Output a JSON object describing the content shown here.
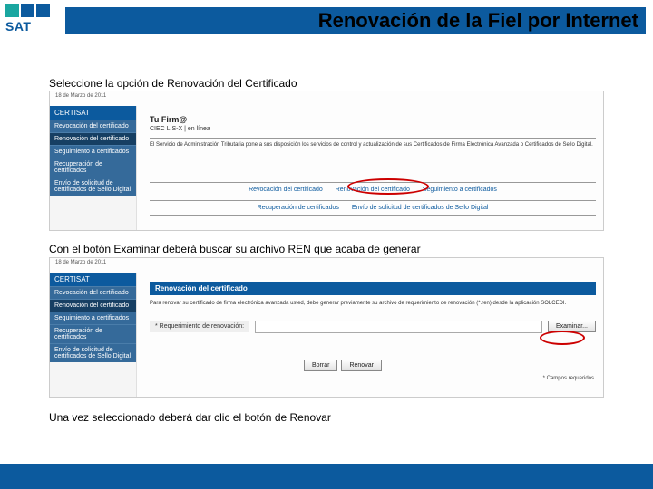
{
  "header": {
    "logo_text": "SAT",
    "title": "Renovación de la Fiel por Internet"
  },
  "instructions": {
    "i1": "Seleccione la opción de Renovación del Certificado",
    "i2": "Con el botón Examinar deberá buscar su archivo REN que acaba de generar",
    "i3": "Una vez seleccionado deberá dar clic  el botón de Renovar"
  },
  "shot1": {
    "date": "18 de Marzo de 2011",
    "sidebar_head": "CERTISAT",
    "sidebar_items": [
      "Revocación del certificado",
      "Renovación del certificado",
      "Seguimiento a certificados",
      "Recuperación de certificados",
      "Envío de solicitud de certificados de Sello Digital"
    ],
    "content_title": "Tu Firm@",
    "content_sub": "CIEC LIS-X | en línea",
    "content_desc": "El Servicio de Administración Tributaria pone a sus disposición los servicios de control y actualización de sus Certificados de Firma Electrónica Avanzada o Certificados de Sello Digital.",
    "links_row1": [
      "Revocación del certificado",
      "Renovación del certificado",
      "Seguimiento a certificados"
    ],
    "links_row2": [
      "Recuperación de certificados",
      "Envío de solicitud de certificados de Sello Digital"
    ]
  },
  "shot2": {
    "date": "18 de Marzo de 2011",
    "sidebar_head": "CERTISAT",
    "sidebar_items": [
      "Revocación del certificado",
      "Renovación del certificado",
      "Seguimiento a certificados",
      "Recuperación de certificados",
      "Envío de solicitud de certificados de Sello Digital"
    ],
    "section_title": "Renovación del certificado",
    "section_desc": "Para renovar su certificado de firma electrónica avanzada usted, debe generar previamente su archivo de requerimiento de renovación (*.ren) desde la aplicación SOLCEDI.",
    "field_label": "* Requerimiento de renovación:",
    "btn_examinar": "Examinar...",
    "btn_borrar": "Borrar",
    "btn_renovar": "Renovar",
    "required_note": "* Campos requeridos"
  }
}
